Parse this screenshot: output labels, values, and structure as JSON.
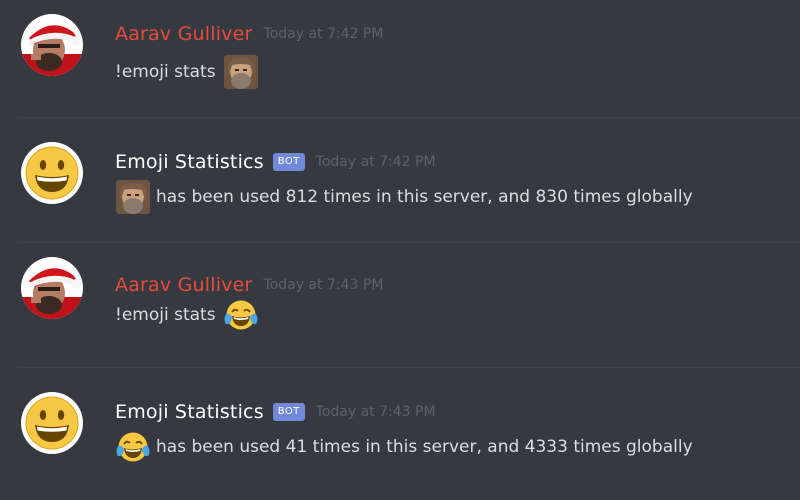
{
  "messages": [
    {
      "author": "Aarav Gulliver",
      "timestamp": "Today at 7:42 PM",
      "text": "!emoji stats",
      "emoji": "stallman-face-emoji"
    },
    {
      "author": "Emoji Statistics",
      "bot_tag": "BOT",
      "timestamp": "Today at 7:42 PM",
      "text": "has been used 812 times in this server, and 830 times globally",
      "emoji": "stallman-face-emoji"
    },
    {
      "author": "Aarav Gulliver",
      "timestamp": "Today at 7:43 PM",
      "text": "!emoji stats",
      "emoji": "tears-of-joy-emoji"
    },
    {
      "author": "Emoji Statistics",
      "bot_tag": "BOT",
      "timestamp": "Today at 7:43 PM",
      "text": "has been used 41 times in this server, and 4333 times globally",
      "emoji": "tears-of-joy-emoji"
    }
  ],
  "colors": {
    "background": "#36393f",
    "user_name": "#e74c3c",
    "bot_name": "#ffffff",
    "bot_tag": "#7289da",
    "timestamp": "#5f6269",
    "message_text": "#dcddde"
  }
}
